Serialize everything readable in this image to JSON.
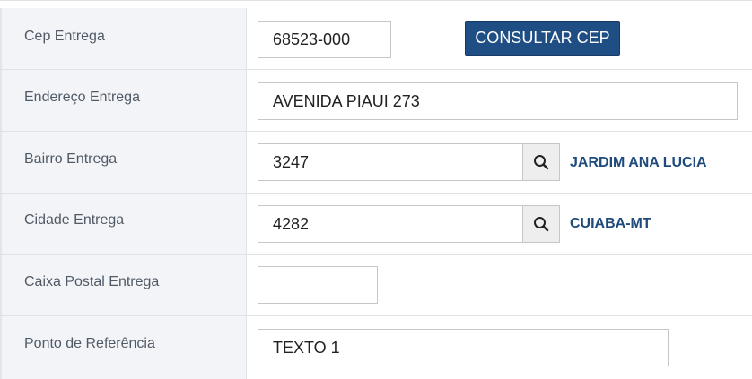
{
  "fields": {
    "cep": {
      "label": "Cep Entrega",
      "value": "68523-000",
      "button_label": "CONSULTAR CEP"
    },
    "endereco": {
      "label": "Endereço Entrega",
      "value": "AVENIDA PIAUI 273"
    },
    "bairro": {
      "label": "Bairro Entrega",
      "value": "3247",
      "lookup_text": "JARDIM ANA LUCIA",
      "icon": "search-icon"
    },
    "cidade": {
      "label": "Cidade Entrega",
      "value": "4282",
      "lookup_text": "CUIABA-MT",
      "icon": "search-icon"
    },
    "caixa_postal": {
      "label": "Caixa Postal Entrega",
      "value": ""
    },
    "ponto_referencia": {
      "label": "Ponto de Referência",
      "value": "TEXTO 1"
    }
  },
  "colors": {
    "accent": "#1f4e85",
    "lookup_text": "#1e4a7c",
    "label_bg": "#f3f4f7"
  }
}
